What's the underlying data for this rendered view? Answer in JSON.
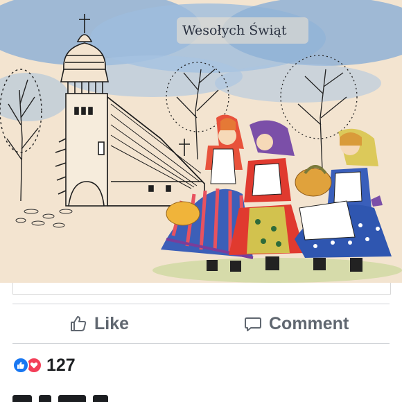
{
  "post": {
    "card_greeting": "Wesołych Świąt",
    "card_alt": "Easter postcard illustration of a wooden church and three girls in folk costumes carrying baskets"
  },
  "actions": {
    "like_label": "Like",
    "comment_label": "Comment"
  },
  "reactions": {
    "types": [
      "like",
      "love"
    ],
    "count": "127"
  },
  "colors": {
    "action_text": "#606770",
    "like_blue": "#1877f2",
    "love_red": "#f33e58"
  }
}
